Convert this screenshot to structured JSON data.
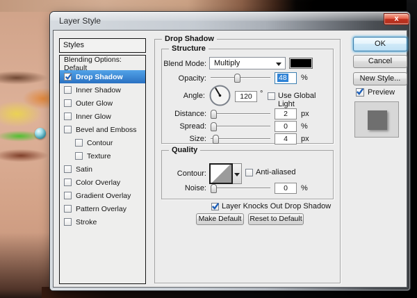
{
  "window": {
    "title": "Layer Style"
  },
  "icons": {
    "close": "x"
  },
  "sidebar": {
    "header": "Styles",
    "items": [
      {
        "label": "Blending Options: Default",
        "has_checkbox": false,
        "checked": false,
        "selected": false,
        "indent": false
      },
      {
        "label": "Drop Shadow",
        "has_checkbox": true,
        "checked": true,
        "selected": true,
        "indent": false
      },
      {
        "label": "Inner Shadow",
        "has_checkbox": true,
        "checked": false,
        "selected": false,
        "indent": false
      },
      {
        "label": "Outer Glow",
        "has_checkbox": true,
        "checked": false,
        "selected": false,
        "indent": false
      },
      {
        "label": "Inner Glow",
        "has_checkbox": true,
        "checked": false,
        "selected": false,
        "indent": false
      },
      {
        "label": "Bevel and Emboss",
        "has_checkbox": true,
        "checked": false,
        "selected": false,
        "indent": false
      },
      {
        "label": "Contour",
        "has_checkbox": true,
        "checked": false,
        "selected": false,
        "indent": true
      },
      {
        "label": "Texture",
        "has_checkbox": true,
        "checked": false,
        "selected": false,
        "indent": true
      },
      {
        "label": "Satin",
        "has_checkbox": true,
        "checked": false,
        "selected": false,
        "indent": false
      },
      {
        "label": "Color Overlay",
        "has_checkbox": true,
        "checked": false,
        "selected": false,
        "indent": false
      },
      {
        "label": "Gradient Overlay",
        "has_checkbox": true,
        "checked": false,
        "selected": false,
        "indent": false
      },
      {
        "label": "Pattern Overlay",
        "has_checkbox": true,
        "checked": false,
        "selected": false,
        "indent": false
      },
      {
        "label": "Stroke",
        "has_checkbox": true,
        "checked": false,
        "selected": false,
        "indent": false
      }
    ]
  },
  "panel": {
    "group_title": "Drop Shadow",
    "structure": {
      "title": "Structure",
      "blend_mode_label": "Blend Mode:",
      "blend_mode_value": "Multiply",
      "opacity_label": "Opacity:",
      "opacity_value": "48",
      "opacity_unit": "%",
      "angle_label": "Angle:",
      "angle_value": "120",
      "angle_unit": "°",
      "use_global_light_label": "Use Global Light",
      "use_global_light_checked": false,
      "distance_label": "Distance:",
      "distance_value": "2",
      "distance_unit": "px",
      "spread_label": "Spread:",
      "spread_value": "0",
      "spread_unit": "%",
      "size_label": "Size:",
      "size_value": "4",
      "size_unit": "px",
      "angle_degrees": 120,
      "opacity_slider_pct": 45,
      "distance_slider_pct": 2,
      "spread_slider_pct": 0,
      "size_slider_pct": 3
    },
    "quality": {
      "title": "Quality",
      "contour_label": "Contour:",
      "anti_aliased_label": "Anti-aliased",
      "anti_aliased_checked": false,
      "noise_label": "Noise:",
      "noise_value": "0",
      "noise_unit": "%",
      "noise_slider_pct": 0
    },
    "knockout_label": "Layer Knocks Out Drop Shadow",
    "knockout_checked": true,
    "make_default_label": "Make Default",
    "reset_default_label": "Reset to Default"
  },
  "actions": {
    "ok_label": "OK",
    "cancel_label": "Cancel",
    "new_style_label": "New Style...",
    "preview_label": "Preview",
    "preview_checked": true
  },
  "colors": {
    "selection_blue": "#2a71c2",
    "blend_swatch": "#000000",
    "preview_square": "#6f6f6f",
    "close_button_red": "#b42f1e"
  }
}
